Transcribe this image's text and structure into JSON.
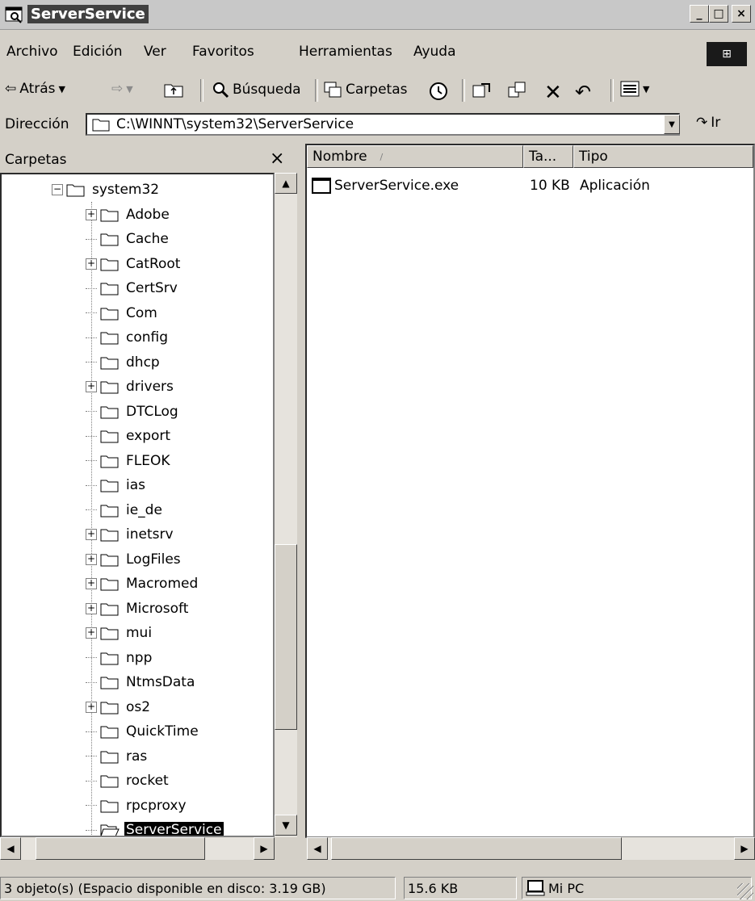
{
  "window": {
    "title": "ServerService",
    "controls": [
      "_",
      "□",
      "×"
    ]
  },
  "menubar": {
    "items": [
      "Archivo",
      "Edición",
      "Ver",
      "Favoritos",
      "Herramientas",
      "Ayuda"
    ]
  },
  "toolbar": {
    "back_label": "Atrás",
    "search_label": "Búsqueda",
    "folders_label": "Carpetas"
  },
  "address": {
    "label": "Dirección",
    "value": "C:\\WINNT\\system32\\ServerService",
    "go_label": "Ir"
  },
  "left_pane": {
    "title": "Carpetas",
    "root_item": "system32",
    "items": [
      {
        "label": "Adobe",
        "expandable": true
      },
      {
        "label": "Cache",
        "expandable": false
      },
      {
        "label": "CatRoot",
        "expandable": true
      },
      {
        "label": "CertSrv",
        "expandable": false
      },
      {
        "label": "Com",
        "expandable": false
      },
      {
        "label": "config",
        "expandable": false
      },
      {
        "label": "dhcp",
        "expandable": false
      },
      {
        "label": "drivers",
        "expandable": true
      },
      {
        "label": "DTCLog",
        "expandable": false
      },
      {
        "label": "export",
        "expandable": false
      },
      {
        "label": "FLEOK",
        "expandable": false
      },
      {
        "label": "ias",
        "expandable": false
      },
      {
        "label": "ie_de",
        "expandable": false
      },
      {
        "label": "inetsrv",
        "expandable": true
      },
      {
        "label": "LogFiles",
        "expandable": true
      },
      {
        "label": "Macromed",
        "expandable": true
      },
      {
        "label": "Microsoft",
        "expandable": true
      },
      {
        "label": "mui",
        "expandable": true
      },
      {
        "label": "npp",
        "expandable": false
      },
      {
        "label": "NtmsData",
        "expandable": false
      },
      {
        "label": "os2",
        "expandable": true
      },
      {
        "label": "QuickTime",
        "expandable": false
      },
      {
        "label": "ras",
        "expandable": false
      },
      {
        "label": "rocket",
        "expandable": false
      },
      {
        "label": "rpcproxy",
        "expandable": false
      },
      {
        "label": "ServerService",
        "expandable": false,
        "selected": true
      }
    ]
  },
  "right_pane": {
    "columns": [
      "Nombre",
      "Ta...",
      "Tipo"
    ],
    "files": [
      {
        "name": "ServerService.exe",
        "size": "10 KB",
        "type": "Aplicación"
      }
    ]
  },
  "statusbar": {
    "objects": "3 objeto(s) (Espacio disponible en disco:  3.19 GB)",
    "size": "15.6 KB",
    "location": "Mi PC"
  }
}
